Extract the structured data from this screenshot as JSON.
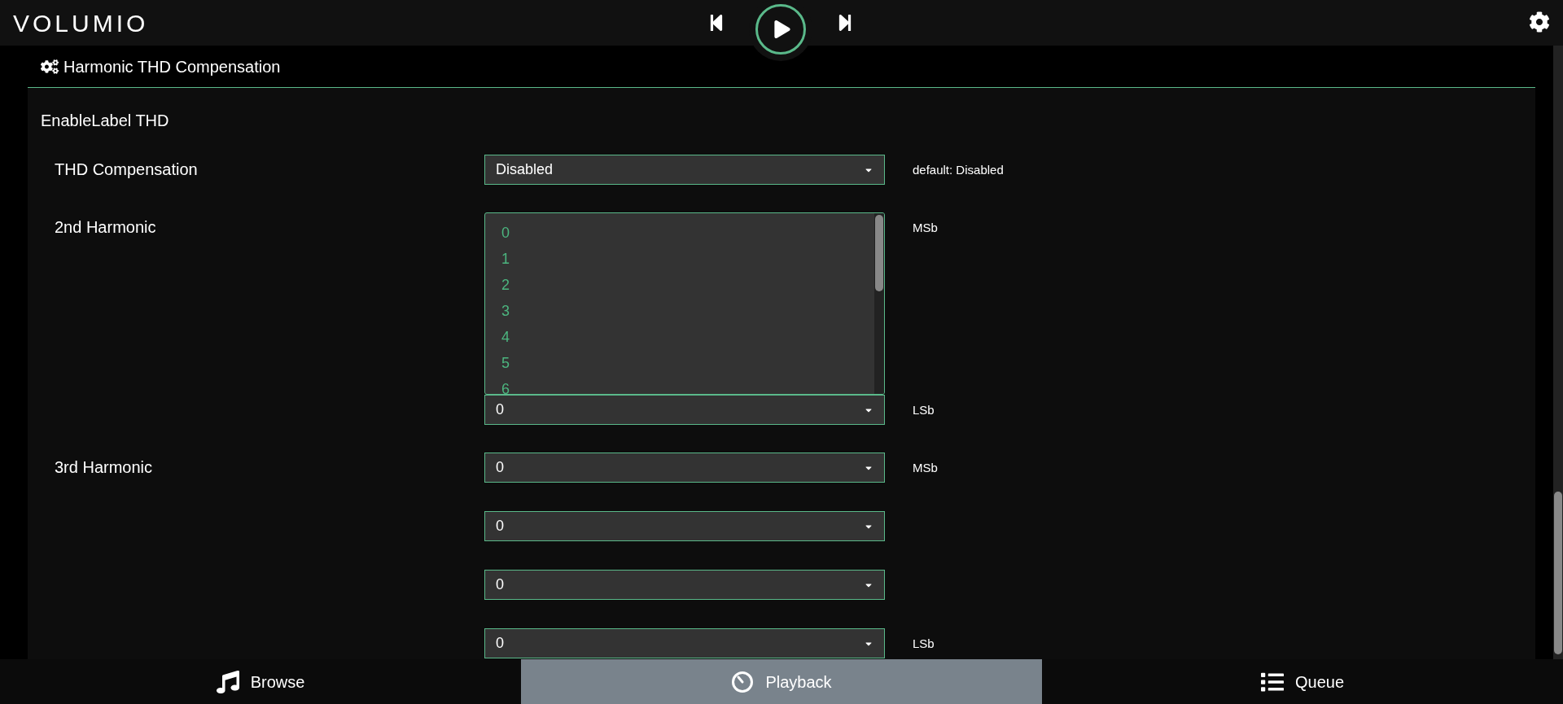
{
  "header": {
    "logo": "VOLUMIO"
  },
  "section": {
    "title": "Harmonic THD Compensation",
    "group_label": "EnableLabel THD",
    "rows": [
      {
        "label": "THD Compensation",
        "controls": [
          {
            "kind": "select",
            "value": "Disabled",
            "note": "default: Disabled"
          }
        ]
      },
      {
        "label": "2nd Harmonic",
        "controls": [
          {
            "kind": "listbox",
            "options": [
              "0",
              "1",
              "2",
              "3",
              "4",
              "5",
              "6"
            ],
            "note": "MSb"
          },
          {
            "kind": "select",
            "value": "0",
            "note": "LSb"
          }
        ]
      },
      {
        "label": "3rd Harmonic",
        "controls": [
          {
            "kind": "select",
            "value": "0",
            "note": "MSb"
          },
          {
            "kind": "select",
            "value": "0"
          },
          {
            "kind": "select",
            "value": "0"
          },
          {
            "kind": "select",
            "value": "0",
            "note": "LSb"
          }
        ]
      }
    ]
  },
  "nav": [
    {
      "label": "Browse",
      "kind": "browse",
      "selected": false
    },
    {
      "label": "Playback",
      "kind": "playback",
      "selected": true
    },
    {
      "label": "Queue",
      "kind": "queue",
      "selected": false
    }
  ]
}
